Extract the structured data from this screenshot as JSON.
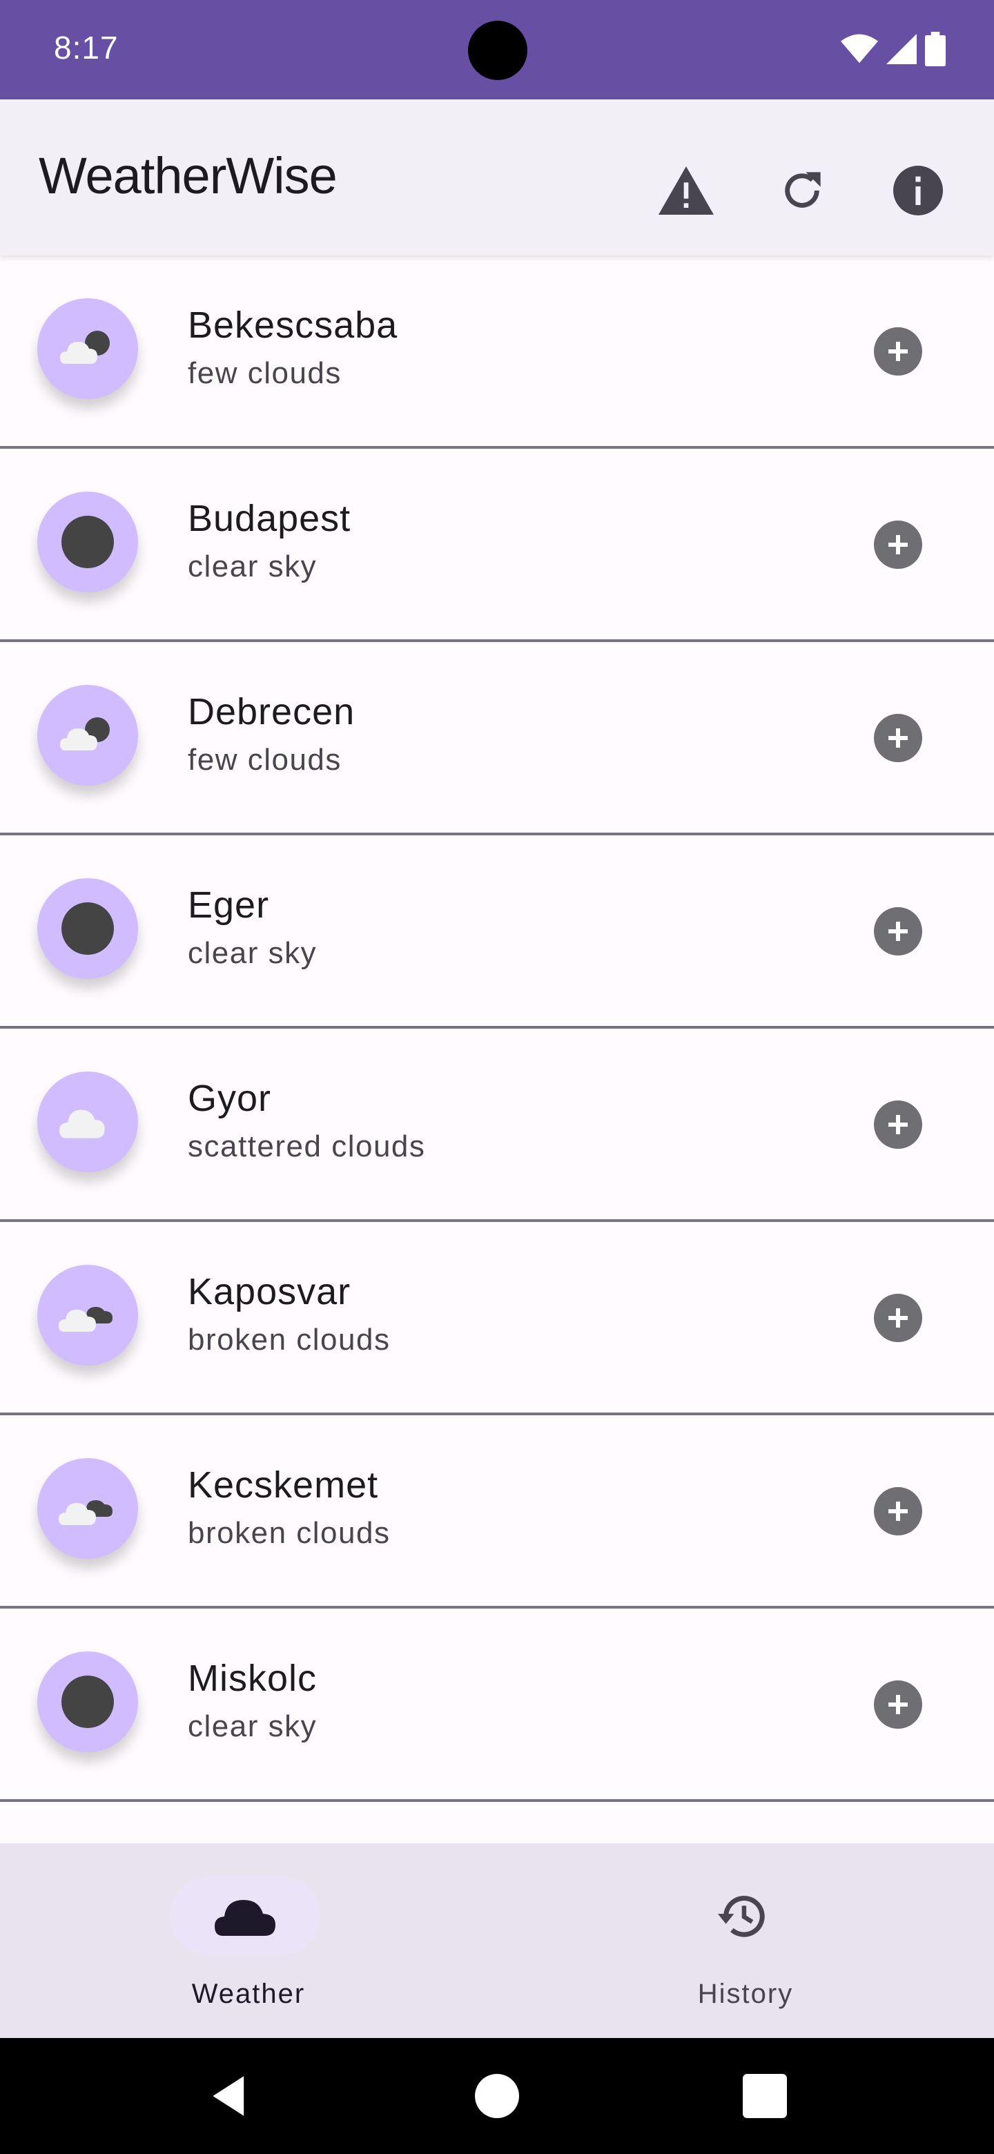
{
  "status_bar": {
    "time": "8:17"
  },
  "app_bar": {
    "title": "WeatherWise"
  },
  "actions": [
    {
      "name": "warning-icon"
    },
    {
      "name": "refresh-icon"
    },
    {
      "name": "info-icon"
    }
  ],
  "cities": [
    {
      "name": "Bekescsaba",
      "description": "few clouds",
      "icon": "few-clouds-icon"
    },
    {
      "name": "Budapest",
      "description": "clear sky",
      "icon": "clear-sky-icon"
    },
    {
      "name": "Debrecen",
      "description": "few clouds",
      "icon": "few-clouds-icon"
    },
    {
      "name": "Eger",
      "description": "clear sky",
      "icon": "clear-sky-icon"
    },
    {
      "name": "Gyor",
      "description": "scattered clouds",
      "icon": "scattered-clouds-icon"
    },
    {
      "name": "Kaposvar",
      "description": "broken clouds",
      "icon": "broken-clouds-icon"
    },
    {
      "name": "Kecskemet",
      "description": "broken clouds",
      "icon": "broken-clouds-icon"
    },
    {
      "name": "Miskolc",
      "description": "clear sky",
      "icon": "clear-sky-icon"
    }
  ],
  "bottom_nav": [
    {
      "label": "Weather",
      "icon": "cloud-icon",
      "selected": true
    },
    {
      "label": "History",
      "icon": "history-icon",
      "selected": false
    }
  ],
  "colors": {
    "primary": "#6750A4",
    "avatar": "#D0BCFF",
    "app_bar": "#F3EFF7",
    "nav_bar": "#E8E3EE"
  }
}
